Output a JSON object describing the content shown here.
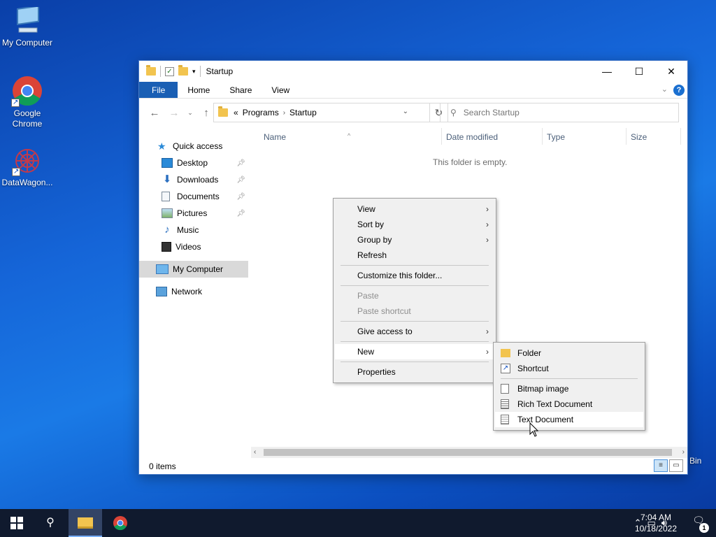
{
  "desktop": {
    "icons": [
      {
        "label": "My Computer"
      },
      {
        "label": "Google Chrome"
      },
      {
        "label": "DataWagon..."
      }
    ],
    "recycle_bin_label_partial": "Bin"
  },
  "window": {
    "title": "Startup",
    "ribbon_tabs": [
      "File",
      "Home",
      "Share",
      "View"
    ],
    "address": {
      "overflow": "«",
      "crumbs": [
        "Programs",
        "Startup"
      ]
    },
    "search_placeholder": "Search Startup",
    "nav": {
      "quick_access": "Quick access",
      "items": [
        {
          "label": "Desktop",
          "pinned": true
        },
        {
          "label": "Downloads",
          "pinned": true
        },
        {
          "label": "Documents",
          "pinned": true
        },
        {
          "label": "Pictures",
          "pinned": true
        },
        {
          "label": "Music",
          "pinned": false
        },
        {
          "label": "Videos",
          "pinned": false
        }
      ],
      "my_computer": "My Computer",
      "network": "Network"
    },
    "columns": [
      "Name",
      "Date modified",
      "Type",
      "Size"
    ],
    "empty_message": "This folder is empty.",
    "status": "0 items"
  },
  "context_menu": {
    "items": [
      {
        "label": "View",
        "submenu": true
      },
      {
        "label": "Sort by",
        "submenu": true
      },
      {
        "label": "Group by",
        "submenu": true
      },
      {
        "label": "Refresh"
      },
      {
        "label": "Customize this folder..."
      },
      {
        "label": "Paste",
        "disabled": true
      },
      {
        "label": "Paste shortcut",
        "disabled": true
      },
      {
        "label": "Give access to",
        "submenu": true
      },
      {
        "label": "New",
        "submenu": true,
        "active": true
      },
      {
        "label": "Properties"
      }
    ]
  },
  "new_submenu": {
    "items": [
      {
        "label": "Folder",
        "icon": "folder-icon"
      },
      {
        "label": "Shortcut",
        "icon": "shortcut-icon"
      },
      {
        "label": "Bitmap image",
        "icon": "bitmap-icon"
      },
      {
        "label": "Rich Text Document",
        "icon": "rtf-icon"
      },
      {
        "label": "Text Document",
        "icon": "text-document-icon",
        "hover": true
      }
    ]
  },
  "taskbar": {
    "time": "7:04 AM",
    "date": "10/18/2022",
    "notification_count": "1"
  },
  "colors": {
    "accent": "#1a5fb4",
    "folder": "#f2c44f",
    "taskbar": "#101a2e"
  }
}
